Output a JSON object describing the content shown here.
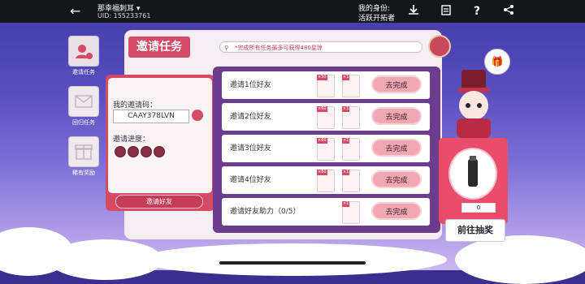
{
  "topbar": {
    "back_icon": "back-arrow-icon",
    "username": "那幸福刺耳 ▾",
    "uid": "UID: 155233761",
    "role_label": "我的身份:",
    "role_value": "活跃开拓者",
    "icons": [
      "download-icon",
      "clipboard-icon",
      "help-icon",
      "share-icon"
    ]
  },
  "sidebar": {
    "items": [
      {
        "label": "邀请任务",
        "icon": "invite-user-icon",
        "active": true
      },
      {
        "label": "回归任务",
        "icon": "mail-icon",
        "active": false
      },
      {
        "label": "稀有奖励",
        "icon": "gift-icon",
        "active": false
      }
    ]
  },
  "panel": {
    "title": "邀请任务",
    "notice": "*完成所有任务最多可获得480星琼"
  },
  "invite": {
    "code_label": "我的邀请码：",
    "code_value": "CAAY378LVN",
    "progress_label": "邀请进度：",
    "progress_filled": 0,
    "progress_total": 4,
    "button_label": "邀请好友"
  },
  "tasks": [
    {
      "label": "邀请1位好友",
      "rewards": [
        {
          "count": "×50",
          "icon": "stellar-jade-icon"
        },
        {
          "count": "×1",
          "icon": "ticket-icon"
        }
      ],
      "button": "去完成"
    },
    {
      "label": "邀请2位好友",
      "rewards": [
        {
          "count": "×60",
          "icon": "stellar-jade-icon"
        },
        {
          "count": "×1",
          "icon": "ticket-icon"
        }
      ],
      "button": "去完成"
    },
    {
      "label": "邀请3位好友",
      "rewards": [
        {
          "count": "×60",
          "icon": "stellar-jade-icon"
        },
        {
          "count": "×1",
          "icon": "ticket-icon"
        }
      ],
      "button": "去完成"
    },
    {
      "label": "邀请4位好友",
      "rewards": [
        {
          "count": "×80",
          "icon": "stellar-jade-icon"
        },
        {
          "count": "×1",
          "icon": "ticket-icon"
        }
      ],
      "button": "去完成"
    },
    {
      "label": "邀请好友助力（0/5）",
      "rewards": [
        {
          "count": "×1",
          "icon": "ticket-icon"
        }
      ],
      "button": "去完成"
    }
  ],
  "prize": {
    "count": "0",
    "button": "前往抽奖"
  },
  "colors": {
    "accent": "#d54a66",
    "frame": "#6c3d8f",
    "button_pink": "#f1a7b2"
  }
}
